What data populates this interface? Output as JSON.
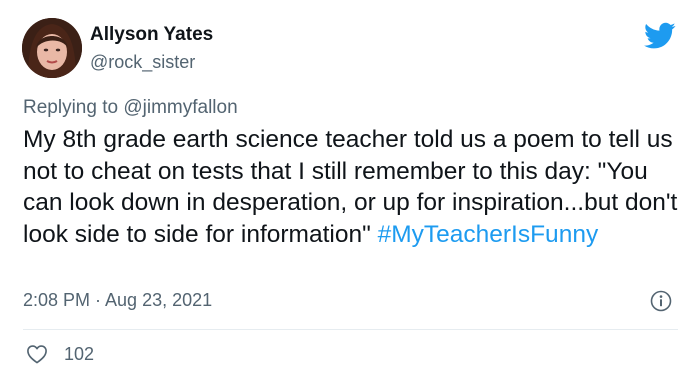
{
  "author": {
    "display_name": "Allyson Yates",
    "handle": "@rock_sister"
  },
  "reply": {
    "prefix": "Replying to ",
    "mention": "@jimmyfallon"
  },
  "tweet": {
    "text": "My 8th grade earth science teacher told us a poem to tell us not to cheat on tests that I still remember to this day: \"You can look down in desperation, or up for inspiration...but don't look side to side for information\" ",
    "hashtag": "#MyTeacherIsFunny",
    "timestamp": "2:08 PM · Aug 23, 2021"
  },
  "engagement": {
    "like_count": "102"
  },
  "icons": {
    "brand": "twitter-bird-icon",
    "info": "info-icon",
    "like": "heart-icon"
  },
  "colors": {
    "brand_blue": "#1d9bf0",
    "secondary_text": "#536471",
    "primary_text": "#0f1419"
  }
}
